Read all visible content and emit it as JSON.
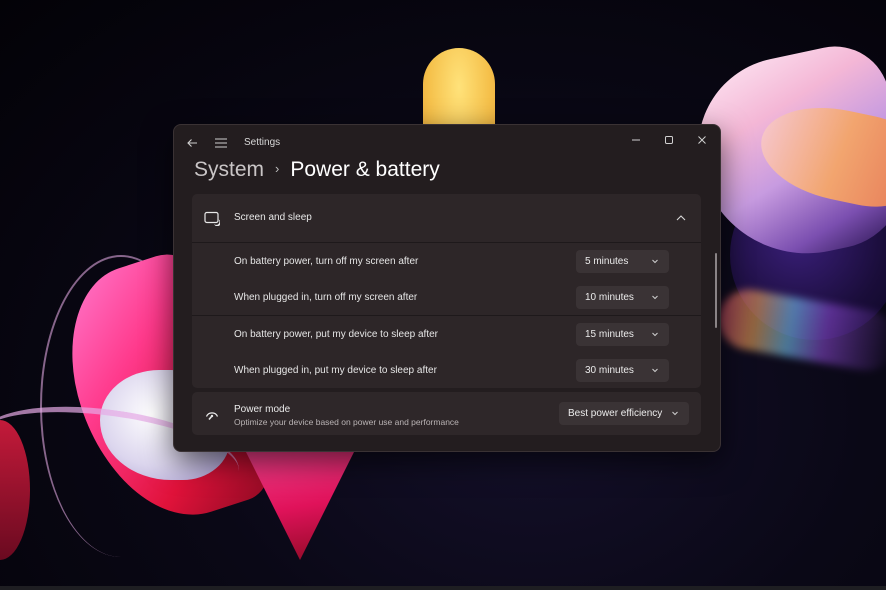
{
  "window": {
    "app_title": "Settings",
    "icons": {
      "back": "back-arrow-icon",
      "menu": "hamburger-menu-icon",
      "minimize": "minimize-icon",
      "maximize": "maximize-icon",
      "close": "close-icon"
    }
  },
  "breadcrumb": {
    "parent": "System",
    "separator": "›",
    "current": "Power & battery"
  },
  "screen_and_sleep": {
    "title": "Screen and sleep",
    "icon": "screen-sleep-icon",
    "expanded": true,
    "settings": [
      {
        "label": "On battery power, turn off my screen after",
        "value": "5 minutes"
      },
      {
        "label": "When plugged in, turn off my screen after",
        "value": "10 minutes"
      },
      {
        "label": "On battery power, put my device to sleep after",
        "value": "15 minutes"
      },
      {
        "label": "When plugged in, put my device to sleep after",
        "value": "30 minutes"
      }
    ]
  },
  "power_mode": {
    "title": "Power mode",
    "description": "Optimize your device based on power use and performance",
    "value": "Best power efficiency",
    "icon": "gauge-icon"
  }
}
